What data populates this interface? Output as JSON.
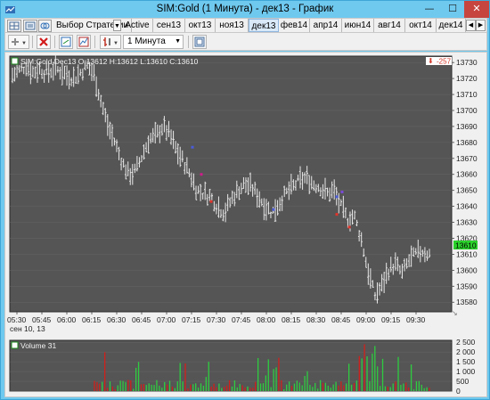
{
  "window": {
    "title": "SIM:Gold (1 Минута) - дек13 - График",
    "minimize_glyph": "—",
    "maximize_glyph": "☐",
    "close_glyph": "✕"
  },
  "tabs": {
    "strategy_label": "Выбор Стратегии",
    "items": [
      "Active",
      "сен13",
      "окт13",
      "ноя13",
      "дек13",
      "фев14",
      "апр14",
      "июн14",
      "авг14",
      "окт14",
      "дек14"
    ],
    "active_index": 4
  },
  "toolbar": {
    "interval_label": "1 Минута"
  },
  "chart": {
    "price_label": "SIM:Gold Dec13 O:13612 H:13612 L:13610 C:13610",
    "price_badge": "-257",
    "last_price": "13610",
    "date_label": "сен 10, 13",
    "volume_label": "Volume 31",
    "colors": {
      "price_bg": "#555555",
      "bar": "#e8e8e8",
      "volume_up": "#2ecc40",
      "volume_down": "#d0201b",
      "last_price_box": "#2bd12b",
      "badge": "#d43a2a"
    }
  },
  "chart_data": [
    {
      "type": "bar",
      "subtype": "ohlc",
      "title": "SIM:Gold Dec13 O:13612 H:13612 L:13610 C:13610",
      "x_ticks": [
        "05:30",
        "05:45",
        "06:00",
        "06:15",
        "06:30",
        "06:45",
        "07:00",
        "07:15",
        "07:30",
        "07:45",
        "08:00",
        "08:15",
        "08:30",
        "08:45",
        "09:00",
        "09:15",
        "09:30"
      ],
      "y_ticks": [
        13580,
        13590,
        13600,
        13610,
        13620,
        13630,
        13640,
        13650,
        13660,
        13670,
        13680,
        13690,
        13700,
        13710,
        13720,
        13730
      ],
      "ylim": [
        13574,
        13734
      ],
      "last_value": 13610,
      "closes_approx": [
        13722,
        13725,
        13728,
        13724,
        13726,
        13723,
        13726,
        13725,
        13722,
        13720,
        13724,
        13728,
        13722,
        13705,
        13690,
        13680,
        13668,
        13660,
        13662,
        13672,
        13682,
        13684,
        13690,
        13685,
        13675,
        13668,
        13660,
        13650,
        13648,
        13646,
        13640,
        13636,
        13644,
        13650,
        13654,
        13652,
        13646,
        13640,
        13636,
        13642,
        13648,
        13652,
        13656,
        13658,
        13654,
        13652,
        13648,
        13650,
        13640,
        13632,
        13634,
        13620,
        13600,
        13584,
        13590,
        13600,
        13604,
        13598,
        13606,
        13610,
        13612,
        13610
      ],
      "grid": true
    },
    {
      "type": "bar",
      "title": "Volume 31",
      "y_ticks": [
        0,
        500,
        1000,
        1500,
        2000,
        2500
      ],
      "ylim": [
        0,
        2600
      ]
    }
  ]
}
